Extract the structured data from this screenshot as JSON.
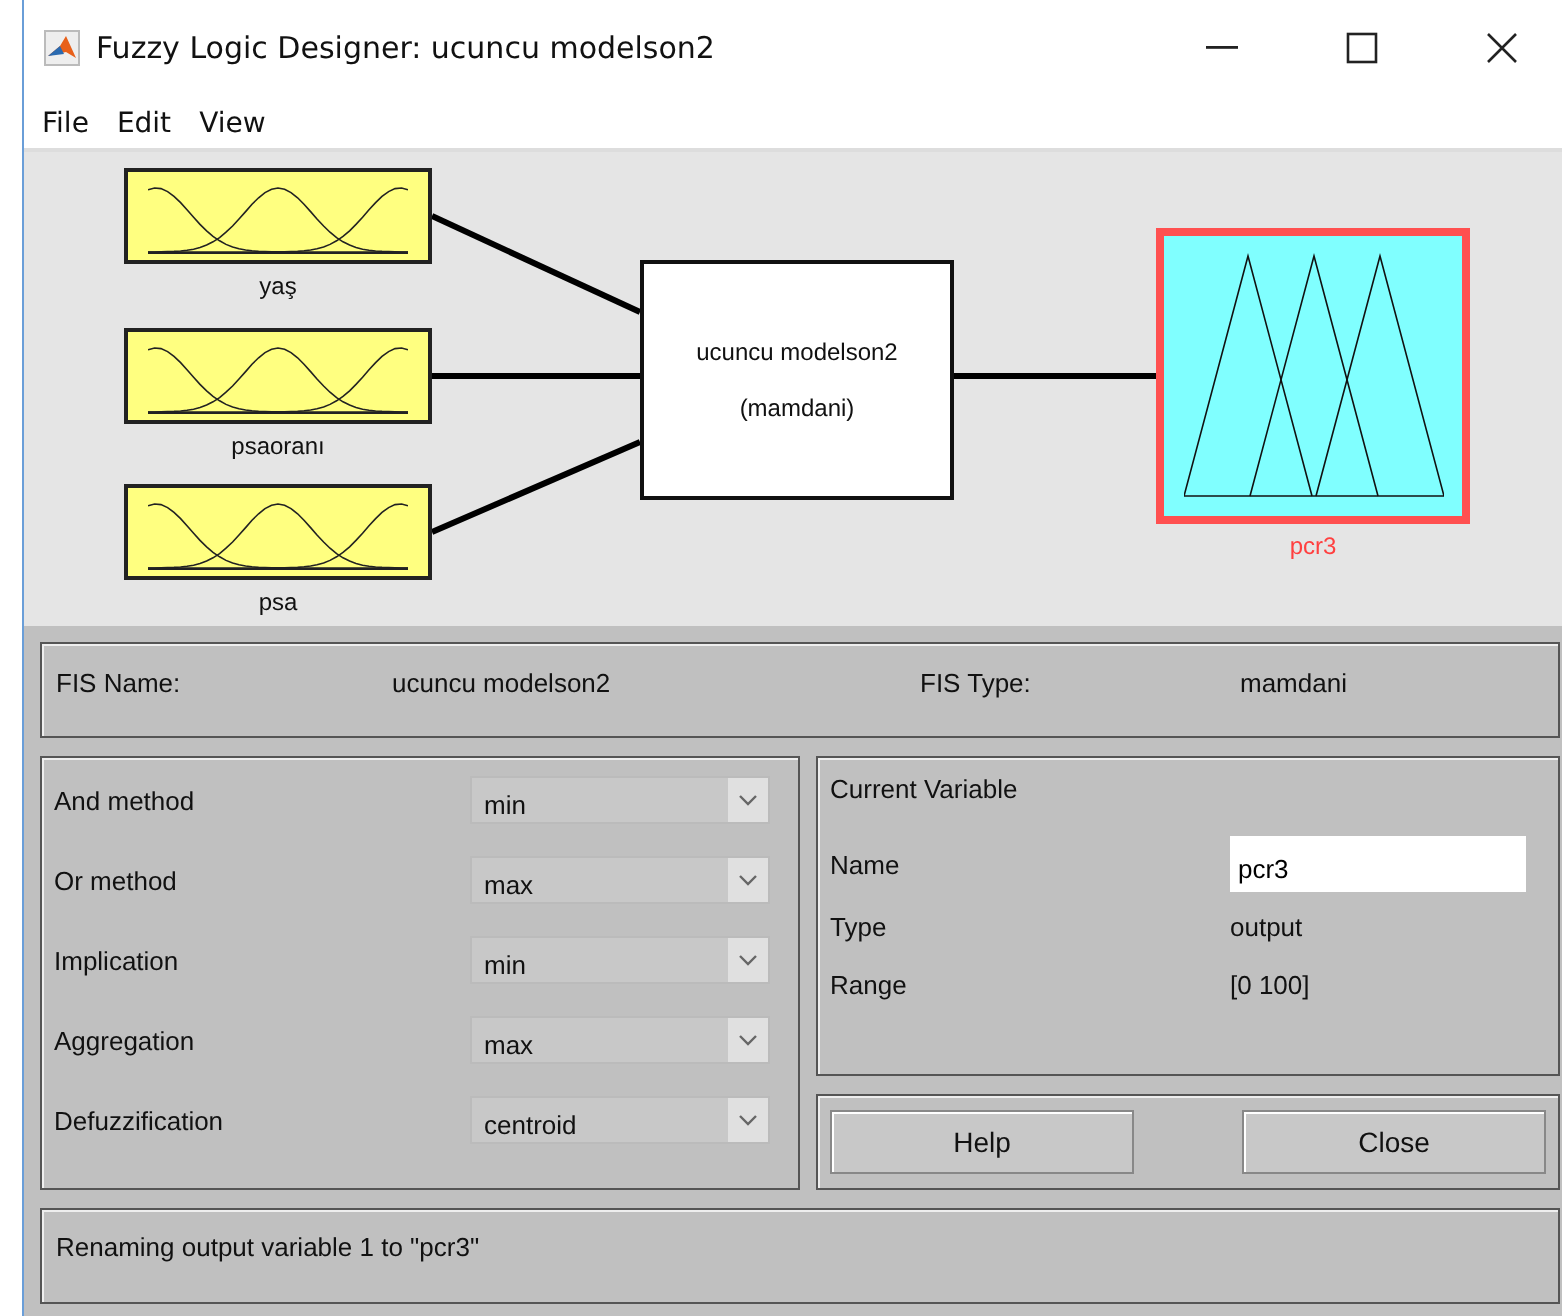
{
  "window": {
    "title": "Fuzzy Logic Designer: ucuncu modelson2"
  },
  "menu": [
    "File",
    "Edit",
    "View"
  ],
  "diagram": {
    "inputs": [
      {
        "name": "yaş"
      },
      {
        "name": "psaoranı"
      },
      {
        "name": "psa"
      }
    ],
    "system": {
      "name": "ucuncu modelson2",
      "type": "(mamdani)"
    },
    "outputs": [
      {
        "name": "pcr3",
        "selected": true
      }
    ]
  },
  "fis": {
    "name_label": "FIS Name:",
    "name": "ucuncu modelson2",
    "type_label": "FIS Type:",
    "type": "mamdani"
  },
  "methods": [
    {
      "label": "And method",
      "value": "min"
    },
    {
      "label": "Or method",
      "value": "max"
    },
    {
      "label": "Implication",
      "value": "min"
    },
    {
      "label": "Aggregation",
      "value": "max"
    },
    {
      "label": "Defuzzification",
      "value": "centroid"
    }
  ],
  "current_variable": {
    "title": "Current Variable",
    "name_label": "Name",
    "name": "pcr3",
    "type_label": "Type",
    "type": "output",
    "range_label": "Range",
    "range": "[0 100]"
  },
  "buttons": [
    "Help",
    "Close"
  ],
  "status": "Renaming output variable 1 to \"pcr3\""
}
